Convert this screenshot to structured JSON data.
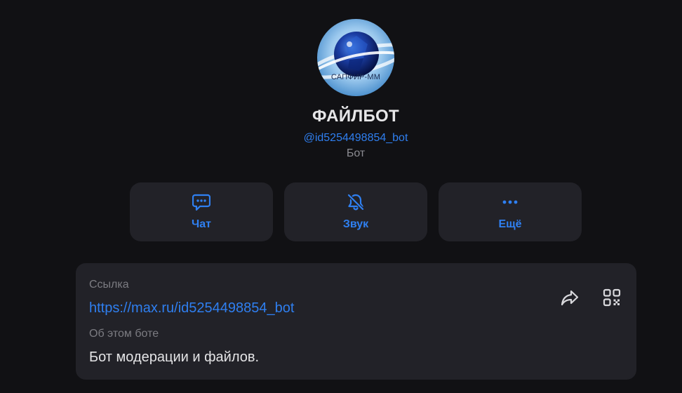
{
  "profile": {
    "avatar_text": "САПФИР-ММ",
    "name": "ФАЙЛБОТ",
    "handle": "@id5254498854_bot",
    "type": "Бот"
  },
  "actions": [
    {
      "label": "Чат",
      "icon": "chat-bubble-icon"
    },
    {
      "label": "Звук",
      "icon": "bell-off-icon"
    },
    {
      "label": "Ещё",
      "icon": "more-dots-icon"
    }
  ],
  "info": {
    "link_label": "Ссылка",
    "link_value": "https://max.ru/id5254498854_bot",
    "about_label": "Об этом боте",
    "about_value": "Бот модерации и файлов.",
    "share_icon": "share-arrow-icon",
    "qr_icon": "qr-code-icon"
  },
  "colors": {
    "background": "#111114",
    "card": "#222228",
    "accent": "#2f80f2",
    "muted": "#7c7c82"
  }
}
